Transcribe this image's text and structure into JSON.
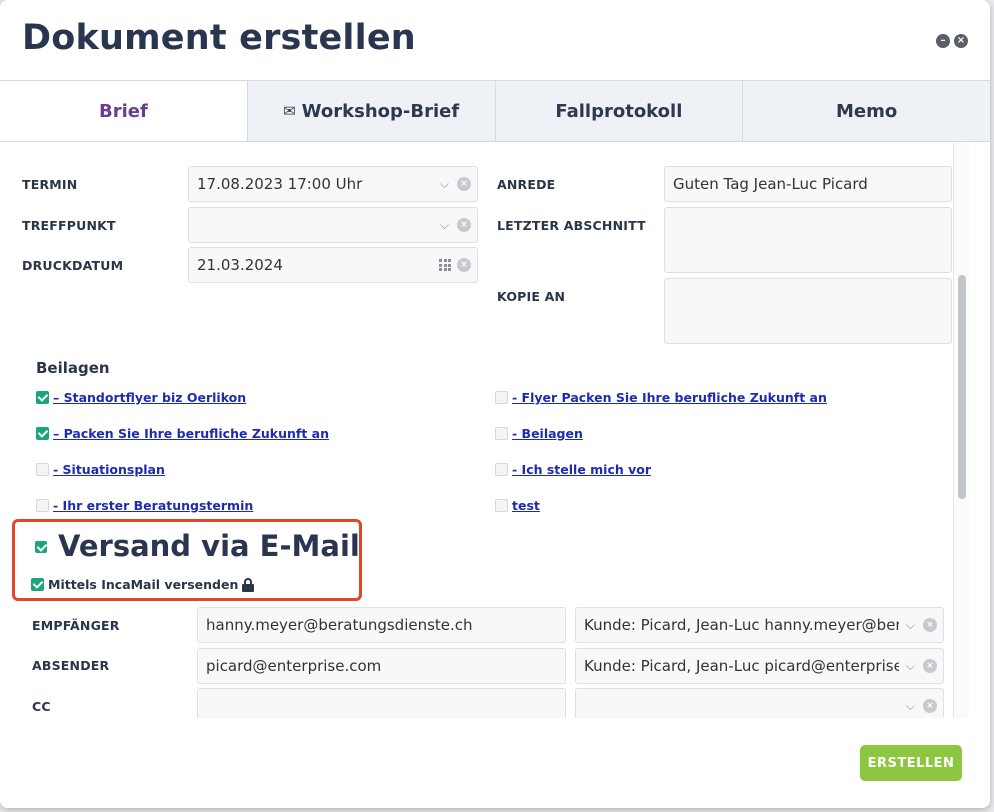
{
  "dialog": {
    "title": "Dokument erstellen"
  },
  "tabs": [
    {
      "label": "Brief",
      "active": true
    },
    {
      "label": "Workshop-Brief",
      "icon": "envelope-icon",
      "active": false
    },
    {
      "label": "Fallprotokoll",
      "active": false
    },
    {
      "label": "Memo",
      "active": false
    }
  ],
  "form": {
    "termin": {
      "label": "TERMIN",
      "value": "17.08.2023 17:00 Uhr"
    },
    "treffpunkt": {
      "label": "TREFFPUNKT",
      "value": ""
    },
    "druckdatum": {
      "label": "DRUCKDATUM",
      "value": "21.03.2024"
    },
    "anrede": {
      "label": "ANREDE",
      "value": "Guten Tag Jean-Luc Picard"
    },
    "letzter_abschnitt": {
      "label": "LETZTER ABSCHNITT",
      "value": ""
    },
    "kopie_an": {
      "label": "KOPIE AN",
      "value": ""
    }
  },
  "beilagen": {
    "title": "Beilagen",
    "items": [
      {
        "label": "– Standortflyer biz Oerlikon",
        "checked": true
      },
      {
        "label": "- Flyer Packen Sie Ihre berufliche Zukunft an",
        "checked": false
      },
      {
        "label": "– Packen Sie Ihre berufliche Zukunft an",
        "checked": true
      },
      {
        "label": "- Beilagen",
        "checked": false
      },
      {
        "label": "- Situationsplan",
        "checked": false
      },
      {
        "label": "- Ich stelle mich vor",
        "checked": false
      },
      {
        "label": "- Ihr erster Beratungstermin",
        "checked": false
      },
      {
        "label": "test",
        "checked": false
      }
    ]
  },
  "versand": {
    "title": "Versand via E-Mail",
    "checked": true,
    "incamail_label": "Mittels IncaMail versenden",
    "incamail_checked": true
  },
  "email": {
    "empfaenger": {
      "label": "EMPFÄNGER",
      "value": "hanny.meyer@beratungsdienste.ch",
      "select": "Kunde: Picard, Jean-Luc hanny.meyer@beratun"
    },
    "absender": {
      "label": "ABSENDER",
      "value": "picard@enterprise.com",
      "select": "Kunde: Picard, Jean-Luc picard@enterprise.com"
    },
    "cc": {
      "label": "CC",
      "value": "",
      "select": ""
    }
  },
  "footer": {
    "create_label": "ERSTELLEN"
  },
  "colors": {
    "accent_tab": "#6a3d92",
    "checkbox": "#1aa57c",
    "link": "#1d2bb3",
    "highlight": "#e0472a",
    "create_button": "#8dc63f"
  }
}
